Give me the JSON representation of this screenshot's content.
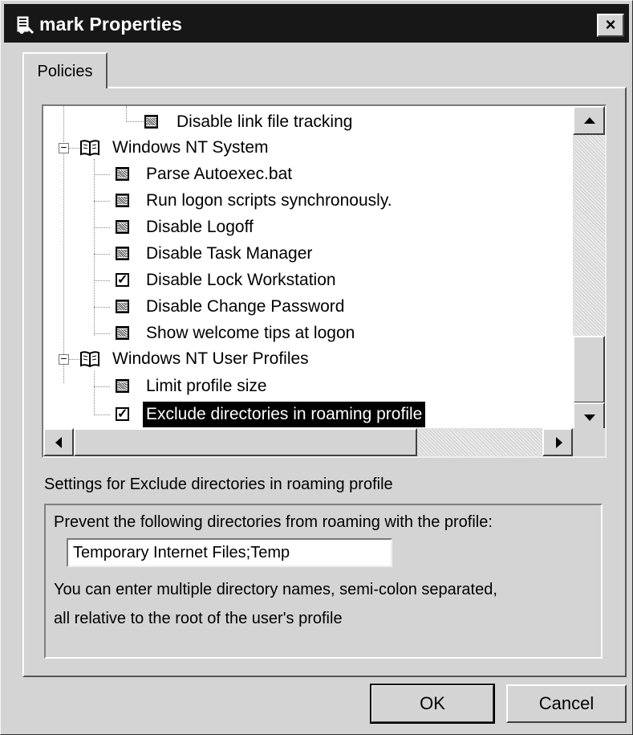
{
  "window": {
    "title": "mark Properties",
    "close_label": "×"
  },
  "tabs": [
    {
      "label": "Policies",
      "active": true
    }
  ],
  "tree": {
    "items": [
      {
        "label": "Disable link file tracking",
        "type": "policy",
        "state": "indeterminate",
        "level": 2
      },
      {
        "label": "Windows NT System",
        "type": "category",
        "expanded": true,
        "level": 0
      },
      {
        "label": "Parse Autoexec.bat",
        "type": "policy",
        "state": "indeterminate",
        "level": 1
      },
      {
        "label": "Run logon scripts synchronously.",
        "type": "policy",
        "state": "indeterminate",
        "level": 1
      },
      {
        "label": "Disable Logoff",
        "type": "policy",
        "state": "indeterminate",
        "level": 1
      },
      {
        "label": "Disable Task Manager",
        "type": "policy",
        "state": "indeterminate",
        "level": 1
      },
      {
        "label": "Disable Lock Workstation",
        "type": "policy",
        "state": "checked",
        "level": 1
      },
      {
        "label": "Disable Change Password",
        "type": "policy",
        "state": "indeterminate",
        "level": 1
      },
      {
        "label": "Show welcome tips at logon",
        "type": "policy",
        "state": "indeterminate",
        "level": 1
      },
      {
        "label": "Windows NT User Profiles",
        "type": "category",
        "expanded": true,
        "level": 0
      },
      {
        "label": "Limit profile size",
        "type": "policy",
        "state": "indeterminate",
        "level": 1
      },
      {
        "label": "Exclude directories in roaming profile",
        "type": "policy",
        "state": "checked",
        "level": 1,
        "selected": true
      }
    ]
  },
  "settings": {
    "heading": "Settings for Exclude directories in roaming profile",
    "prompt": "Prevent the following directories from roaming with the profile:",
    "directories_value": "Temporary Internet Files;Temp",
    "help_line1": "You can enter multiple directory names, semi-colon separated,",
    "help_line2": "all relative to the root of the user's profile"
  },
  "buttons": {
    "ok": "OK",
    "cancel": "Cancel"
  },
  "icons": {
    "window_icon": "policy-editor-icon",
    "category_icon": "book-icon",
    "collapse": "minus-expander-icon"
  }
}
